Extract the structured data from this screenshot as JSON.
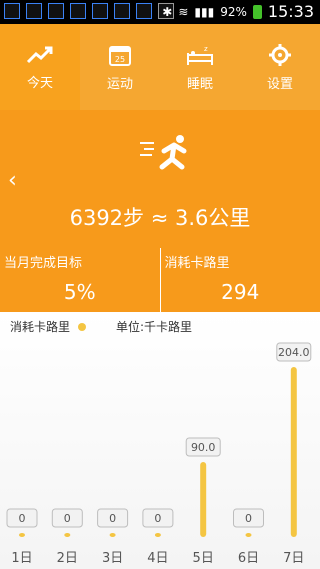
{
  "status_bar": {
    "time": "15:33",
    "battery": "92%"
  },
  "tabs": [
    {
      "label": "今天"
    },
    {
      "label": "运动"
    },
    {
      "label": "睡眠"
    },
    {
      "label": "设置"
    }
  ],
  "hero": {
    "back": "‹",
    "steps_text": "6392步 ≈ 3.6公里"
  },
  "stats": {
    "left_label": "当月完成目标",
    "left_value": "5%",
    "right_label": "消耗卡路里",
    "right_value": "294"
  },
  "chart_header": {
    "legend": "消耗卡路里",
    "unit": "单位:千卡路里"
  },
  "chart_data": {
    "type": "bar",
    "categories": [
      "1日",
      "2日",
      "3日",
      "4日",
      "5日",
      "6日",
      "7日"
    ],
    "values": [
      0,
      0,
      0,
      0,
      90.0,
      0,
      204.0
    ],
    "value_labels": [
      "0",
      "0",
      "0",
      "0",
      "90.0",
      "0",
      "204.0"
    ],
    "ylim": [
      0,
      204
    ],
    "bar_color": "#f4c542"
  }
}
